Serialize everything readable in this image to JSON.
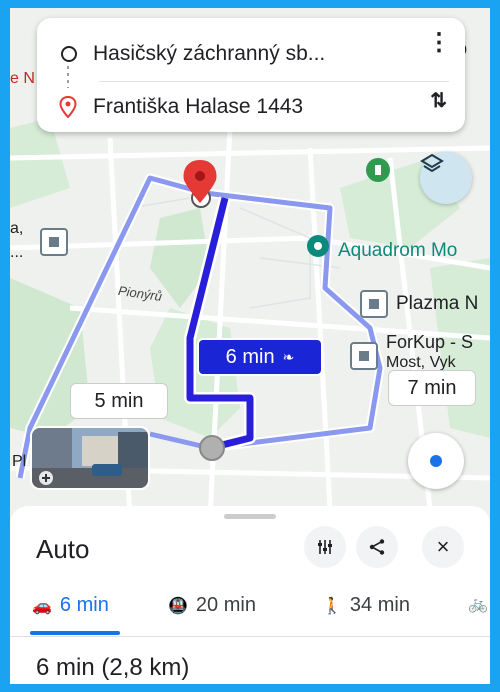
{
  "route": {
    "origin": "Hasičský záchranný sb...",
    "destination": "Františka Halase 1443"
  },
  "map": {
    "labels": {
      "edge_left": "e N",
      "aquadrom": "Aquadrom Mo",
      "plazma": "Plazma N",
      "forkup": "ForKup - S",
      "forkup2": "Most, Vyk",
      "street": "Pionýrů",
      "edge_left_mid": "a,",
      "edge_left_mid2": "...",
      "edge_left_low": "Pl",
      "edge_right_top": "o"
    },
    "time_bubbles": {
      "selected": "6 min",
      "alt_west": "5 min",
      "alt_east": "7 min"
    },
    "colors": {
      "route_main": "#2a1fd9",
      "route_alt": "#8a98f0",
      "accent": "#1a73e8"
    }
  },
  "sheet": {
    "mode": "Auto",
    "tabs": [
      {
        "icon": "car-icon",
        "label": "6 min",
        "active": true
      },
      {
        "icon": "transit-icon",
        "label": "20 min",
        "active": false
      },
      {
        "icon": "walk-icon",
        "label": "34 min",
        "active": false
      }
    ],
    "summary": "6 min (2,8 km)"
  }
}
